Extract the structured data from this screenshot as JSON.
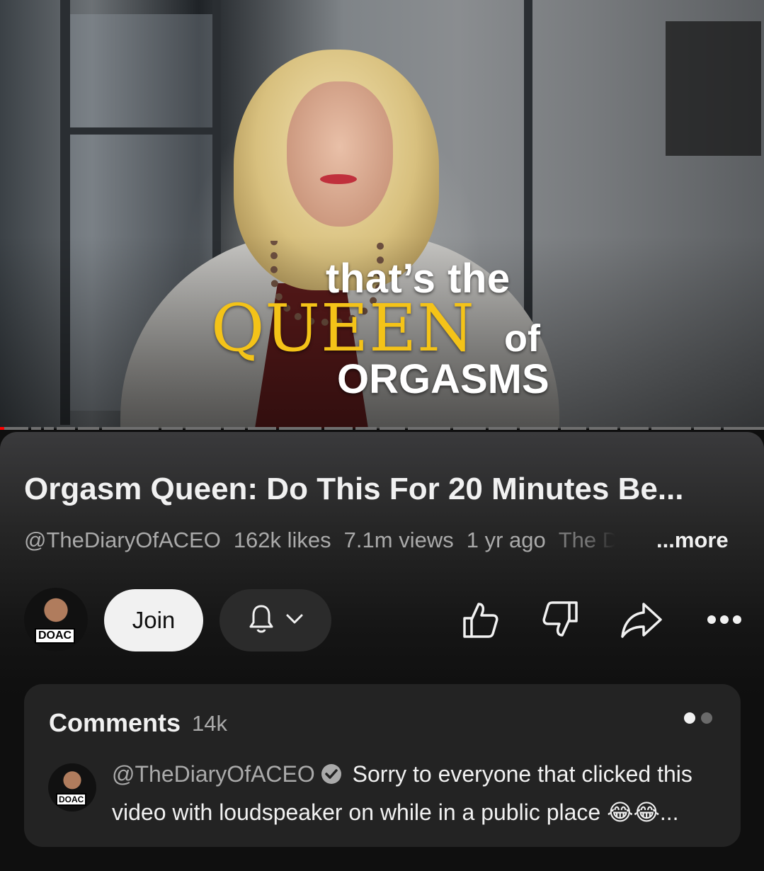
{
  "video": {
    "caption_line1": "that’s the",
    "caption_queen": "QUEEN",
    "caption_of": "of",
    "caption_orgasms": "ORGASMS"
  },
  "info": {
    "title": "Orgasm Queen: Do This For 20 Minutes Be...",
    "channel_handle": "@TheDiaryOfACEO",
    "likes": "162k likes",
    "views": "7.1m views",
    "age": "1 yr ago",
    "description_start": "The D",
    "more_label": "...more"
  },
  "actions": {
    "avatar_badge": "DOAC",
    "join_label": "Join",
    "icons": [
      "bell-icon",
      "chevron-down-icon",
      "like-icon",
      "dislike-icon",
      "share-icon",
      "more-icon"
    ]
  },
  "comments": {
    "heading": "Comments",
    "count": "14k",
    "top_comment": {
      "author": "@TheDiaryOfACEO",
      "avatar_badge": "DOAC",
      "text": "Sorry to everyone that clicked this video with loudspeaker on while in a public place 😂😂..."
    }
  },
  "colors": {
    "background": "#0f0f0f",
    "caption_gold": "#f4c318",
    "join_bg": "#f1f1f1",
    "card_bg": "#232323",
    "secondary_text": "#aaaaaa"
  }
}
